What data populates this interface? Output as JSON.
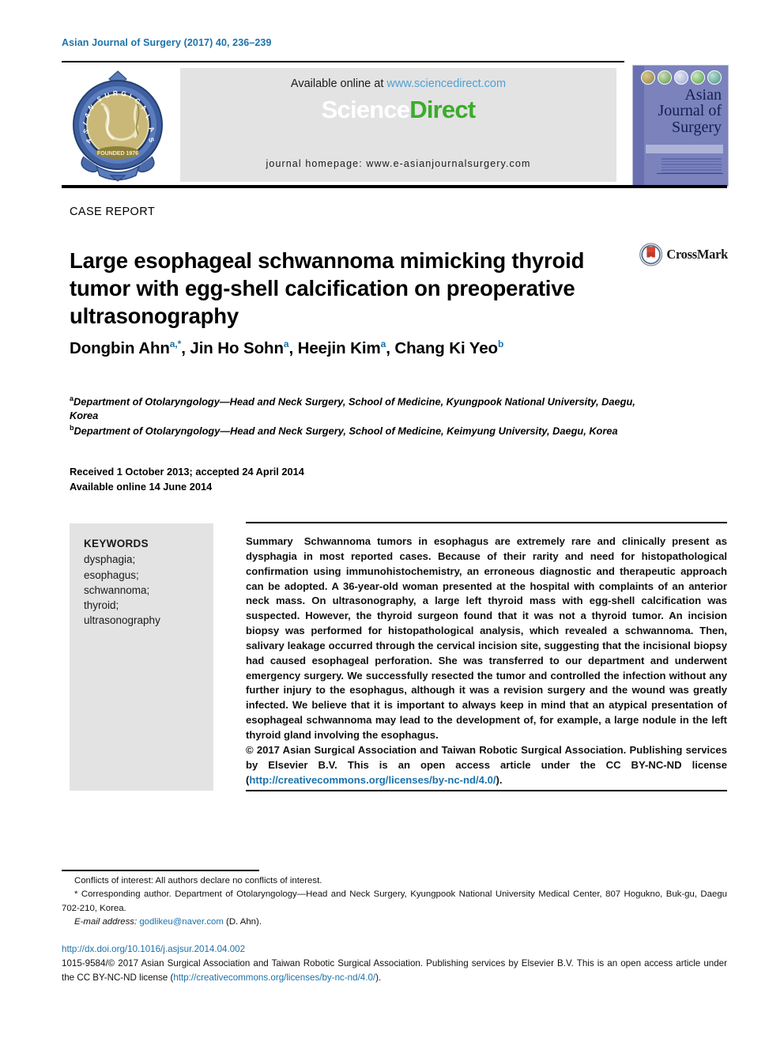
{
  "running_head": "Asian Journal of Surgery (2017) 40, 236–239",
  "masthead": {
    "asa_logo_alt": "Asian Surgical Association",
    "available_online_prefix": "Available online at ",
    "sciencedirect_url": "www.sciencedirect.com",
    "wordmark_science": "Science",
    "wordmark_direct": "Direct",
    "journal_homepage": "journal homepage: www.e-asianjournalsurgery.com",
    "cover": {
      "line1": "Asian",
      "line2": "Journal of",
      "line3": "Surgery"
    }
  },
  "article": {
    "section_label": "CASE REPORT",
    "title": "Large esophageal schwannoma mimicking thyroid tumor with egg-shell calcification on preoperative ultrasonography",
    "crossmark_label": "CrossMark",
    "authors": [
      {
        "name": "Dongbin Ahn",
        "marks": "a,*"
      },
      {
        "name": "Jin Ho Sohn",
        "marks": "a"
      },
      {
        "name": "Heejin Kim",
        "marks": "a"
      },
      {
        "name": "Chang Ki Yeo",
        "marks": "b"
      }
    ],
    "affiliations": [
      {
        "mark": "a",
        "text": "Department of Otolaryngology—Head and Neck Surgery, School of Medicine, Kyungpook National University, Daegu, Korea"
      },
      {
        "mark": "b",
        "text": "Department of Otolaryngology—Head and Neck Surgery, School of Medicine, Keimyung University, Daegu, Korea"
      }
    ],
    "dates_received": "Received 1 October 2013; accepted 24 April 2014",
    "dates_online": "Available online 14 June 2014"
  },
  "keywords": {
    "title": "KEYWORDS",
    "items": [
      "dysphagia;",
      "esophagus;",
      "schwannoma;",
      "thyroid;",
      "ultrasonography"
    ]
  },
  "abstract": {
    "label": "Summary",
    "body": "Schwannoma tumors in esophagus are extremely rare and clinically present as dysphagia in most reported cases. Because of their rarity and need for histopathological confirmation using immunohistochemistry, an erroneous diagnostic and therapeutic approach can be adopted. A 36-year-old woman presented at the hospital with complaints of an anterior neck mass. On ultrasonography, a large left thyroid mass with egg-shell calcification was suspected. However, the thyroid surgeon found that it was not a thyroid tumor. An incision biopsy was performed for histopathological analysis, which revealed a schwannoma. Then, salivary leakage occurred through the cervical incision site, suggesting that the incisional biopsy had caused esophageal perforation. She was transferred to our department and underwent emergency surgery. We successfully resected the tumor and controlled the infection without any further injury to the esophagus, although it was a revision surgery and the wound was greatly infected. We believe that it is important to always keep in mind that an atypical presentation of esophageal schwannoma may lead to the development of, for example, a large nodule in the left thyroid gland involving the esophagus.",
    "copyright_text": "© 2017 Asian Surgical Association and Taiwan Robotic Surgical Association. Publishing services by Elsevier B.V. This is an open access article under the CC BY-NC-ND license (",
    "copyright_link": "http://creativecommons.org/licenses/by-nc-nd/4.0/",
    "copyright_tail": ")."
  },
  "footnotes": {
    "conflicts": "Conflicts of interest: All authors declare no conflicts of interest.",
    "corresponding": "* Corresponding author. Department of Otolaryngology—Head and Neck Surgery, Kyungpook National University Medical Center, 807 Hogukno, Buk-gu, Daegu 702-210, Korea.",
    "email_label": "E-mail address:",
    "email_address": "godlikeu@naver.com",
    "email_owner": "(D. Ahn)."
  },
  "imprint": {
    "doi": "http://dx.doi.org/10.1016/j.asjsur.2014.04.002",
    "legal_prefix": "1015-9584/© 2017 Asian Surgical Association and Taiwan Robotic Surgical Association. Publishing services by Elsevier B.V. This is an open access article under the CC BY-NC-ND license (",
    "legal_link": "http://creativecommons.org/licenses/by-nc-nd/4.0/",
    "legal_tail": ")."
  },
  "colors": {
    "brand_blue": "#1b72ab",
    "sciencedirect_green": "#3bab2c",
    "link_blue": "#4ea0d6",
    "panel_gray": "#e3e3e3",
    "cover_purple": "#7b82bc"
  }
}
